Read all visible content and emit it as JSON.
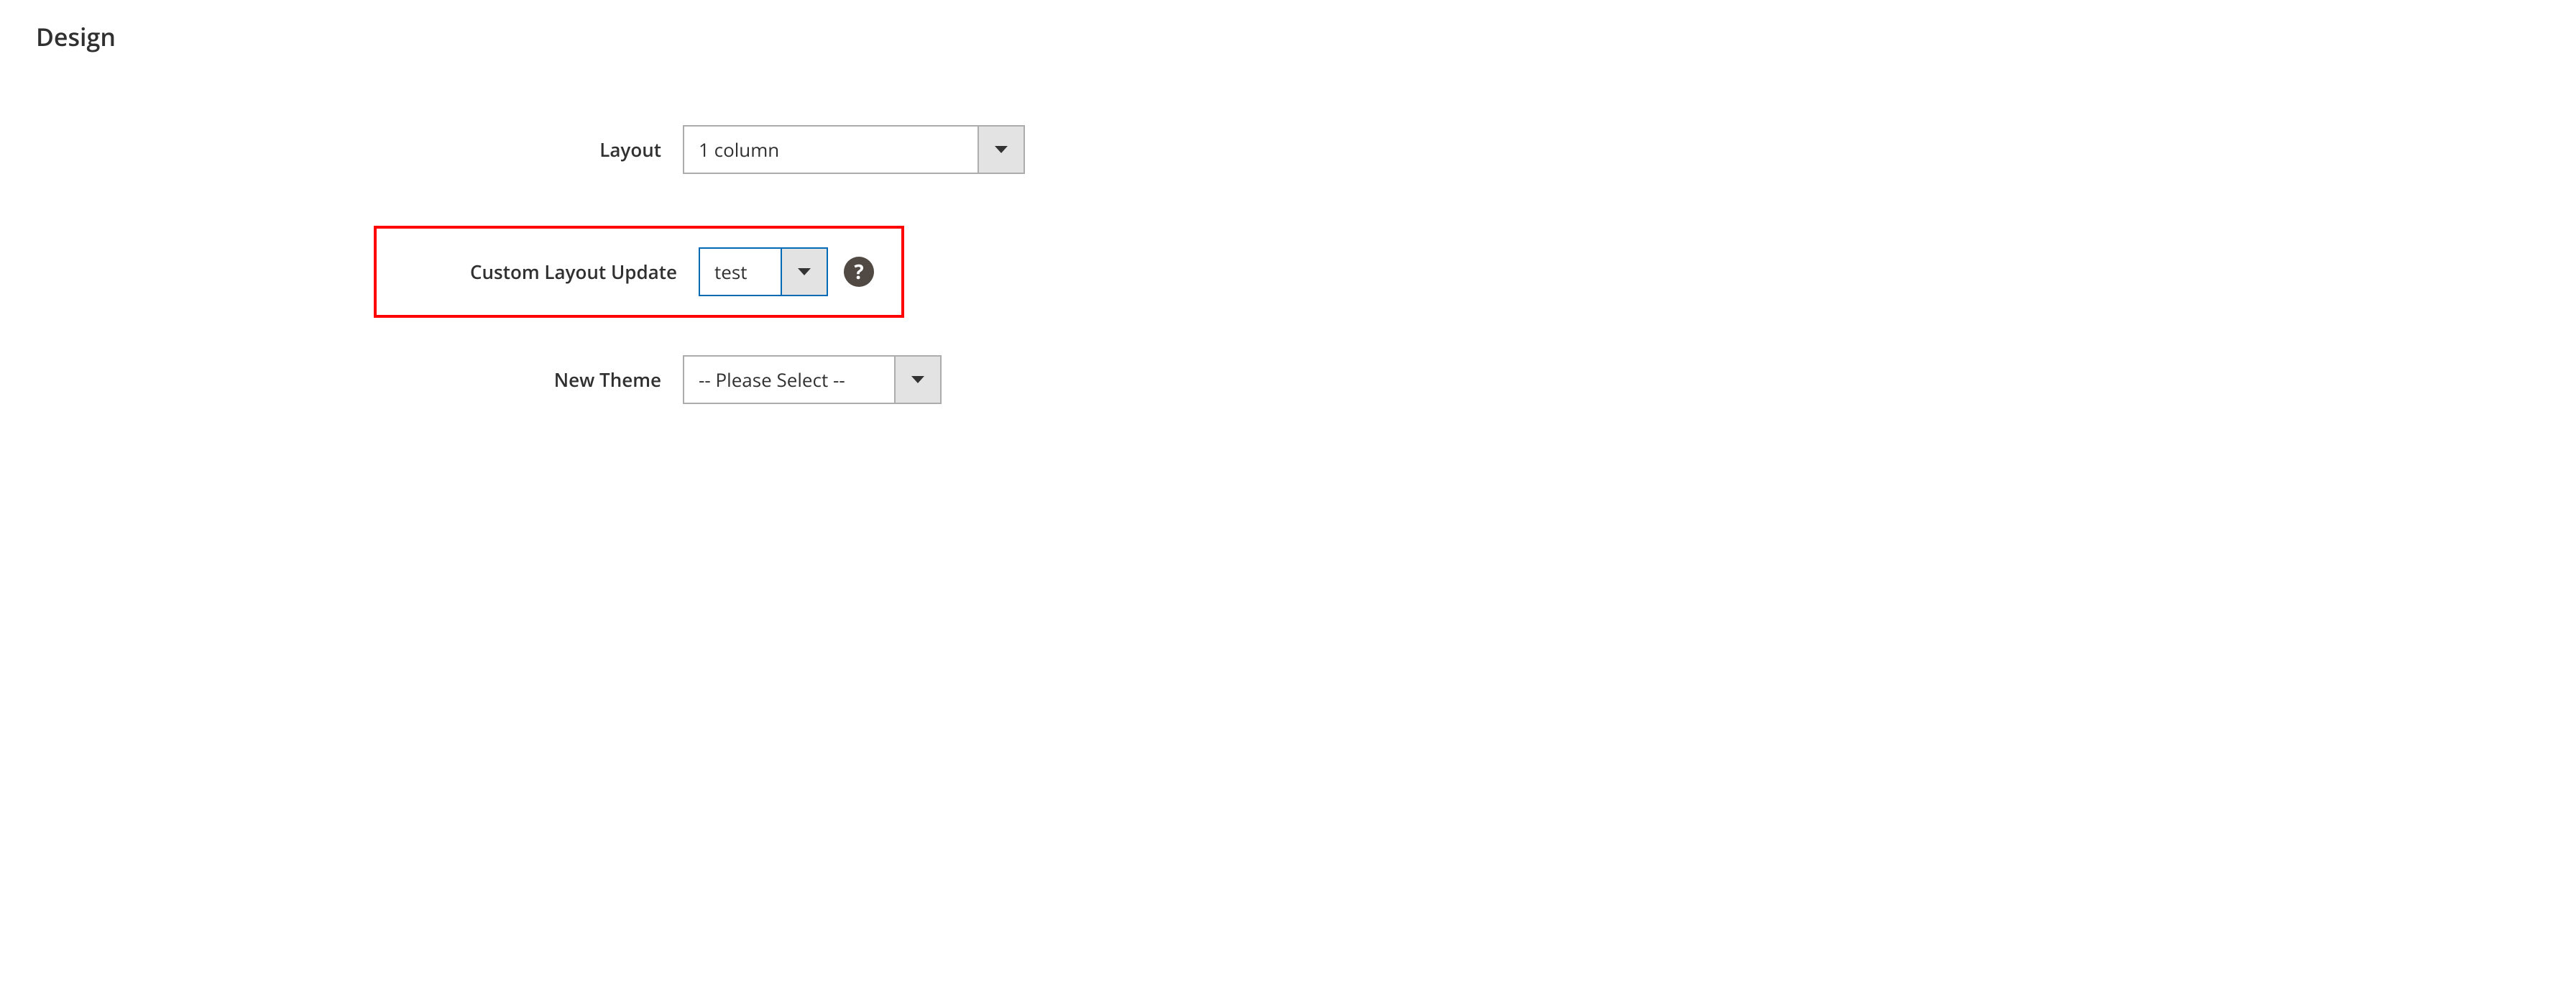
{
  "section": {
    "title": "Design"
  },
  "fields": {
    "layout": {
      "label": "Layout",
      "value": "1 column"
    },
    "custom_layout_update": {
      "label": "Custom Layout Update",
      "value": "test"
    },
    "new_theme": {
      "label": "New Theme",
      "value": "-- Please Select --"
    }
  },
  "help": {
    "glyph": "?"
  }
}
